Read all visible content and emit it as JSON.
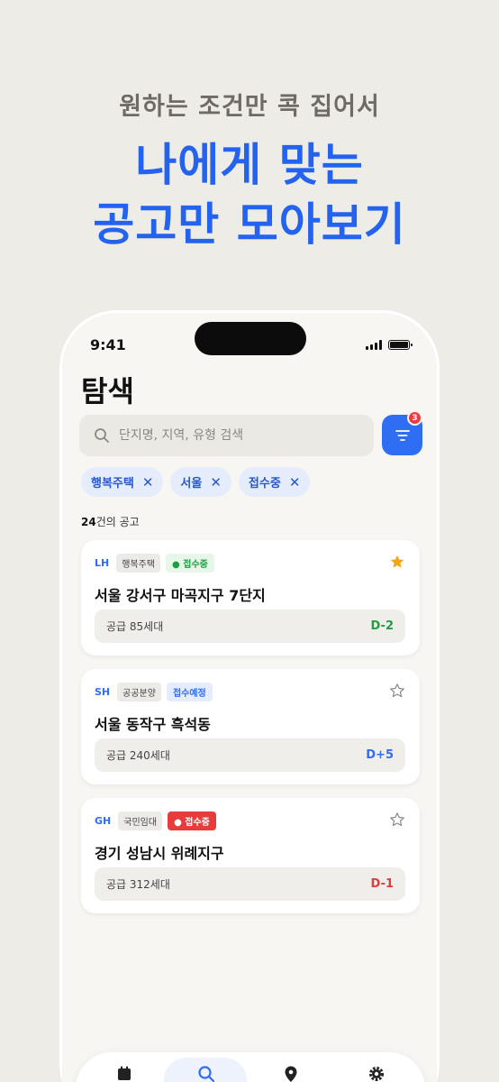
{
  "promo": {
    "subtitle": "원하는 조건만 콕 집어서",
    "title_line1": "나에게 맞는",
    "title_line2": "공고만 모아보기"
  },
  "status_bar": {
    "time": "9:41"
  },
  "page": {
    "title": "탐색"
  },
  "search": {
    "placeholder": "단지명, 지역, 유형 검색"
  },
  "filter": {
    "badge_count": "3"
  },
  "chips": [
    {
      "label": "행복주택"
    },
    {
      "label": "서울"
    },
    {
      "label": "접수중"
    }
  ],
  "results": {
    "count": "24",
    "suffix": "건의 공고"
  },
  "cards": [
    {
      "agency": "LH",
      "type": "행복주택",
      "status": "접수중",
      "status_style": "open",
      "title": "서울 강서구 마곡지구 7단지",
      "supply": "공급 85세대",
      "dday": "D-2",
      "dday_color": "#1f9d43",
      "starred": true
    },
    {
      "agency": "SH",
      "type": "공공분양",
      "status": "접수예정",
      "status_style": "soon",
      "title": "서울 동작구 흑석동",
      "supply": "공급 240세대",
      "dday": "D+5",
      "dday_color": "#2f6ef2",
      "starred": false
    },
    {
      "agency": "GH",
      "type": "국민임대",
      "status": "접수중",
      "status_style": "hot",
      "title": "경기 성남시 위례지구",
      "supply": "공급 312세대",
      "dday": "D-1",
      "dday_color": "#e23b3b",
      "starred": false
    }
  ],
  "colors": {
    "accent": "#2f6ef2",
    "star_active": "#f2a516",
    "background": "#eeece6"
  },
  "tabbar": {
    "icons": [
      "calendar-icon",
      "search-icon",
      "map-pin-icon",
      "settings-icon"
    ],
    "active": "search-icon"
  }
}
